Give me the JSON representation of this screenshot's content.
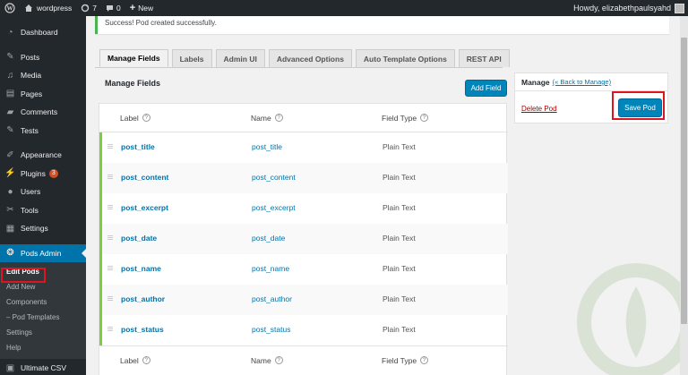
{
  "adminbar": {
    "site_name": "wordpress",
    "updates_count": "7",
    "comments_count": "0",
    "new_label": "New",
    "howdy": "Howdy, elizabethpaulsyahd"
  },
  "sidebar": {
    "items": [
      {
        "label": "Dashboard",
        "icon": "dashboard-icon"
      },
      {
        "label": "Posts",
        "icon": "pin-icon"
      },
      {
        "label": "Media",
        "icon": "media-icon"
      },
      {
        "label": "Pages",
        "icon": "pages-icon"
      },
      {
        "label": "Comments",
        "icon": "comment-icon"
      },
      {
        "label": "Tests",
        "icon": "pin-icon"
      },
      {
        "label": "Appearance",
        "icon": "brush-icon"
      },
      {
        "label": "Plugins",
        "icon": "plugin-icon",
        "badge": "3"
      },
      {
        "label": "Users",
        "icon": "users-icon"
      },
      {
        "label": "Tools",
        "icon": "wrench-icon"
      },
      {
        "label": "Settings",
        "icon": "settings-icon"
      },
      {
        "label": "Pods Admin",
        "icon": "pods-icon"
      },
      {
        "label": "Ultimate CSV",
        "icon": "csv-icon"
      }
    ],
    "submenu": [
      "Edit Pods",
      "Add New",
      "Components",
      "– Pod Templates",
      "Settings",
      "Help"
    ]
  },
  "notice": {
    "text": "Success! Pod created successfully."
  },
  "tabs": [
    "Manage Fields",
    "Labels",
    "Admin UI",
    "Advanced Options",
    "Auto Template Options",
    "REST API"
  ],
  "main": {
    "section_title": "Manage Fields",
    "add_field_label": "Add Field"
  },
  "table": {
    "columns": [
      "Label",
      "Name",
      "Field Type"
    ],
    "rows": [
      {
        "label": "post_title",
        "name": "post_title",
        "type": "Plain Text"
      },
      {
        "label": "post_content",
        "name": "post_content",
        "type": "Plain Text"
      },
      {
        "label": "post_excerpt",
        "name": "post_excerpt",
        "type": "Plain Text"
      },
      {
        "label": "post_date",
        "name": "post_date",
        "type": "Plain Text"
      },
      {
        "label": "post_name",
        "name": "post_name",
        "type": "Plain Text"
      },
      {
        "label": "post_author",
        "name": "post_author",
        "type": "Plain Text"
      },
      {
        "label": "post_status",
        "name": "post_status",
        "type": "Plain Text"
      }
    ]
  },
  "manage": {
    "title": "Manage",
    "back_link": "(« Back to Manage)",
    "delete_label": "Delete Pod",
    "save_label": "Save Pod"
  },
  "colors": {
    "accent": "#0073aa",
    "highlight": "#e0141e",
    "active_border": "#7ad03a"
  }
}
